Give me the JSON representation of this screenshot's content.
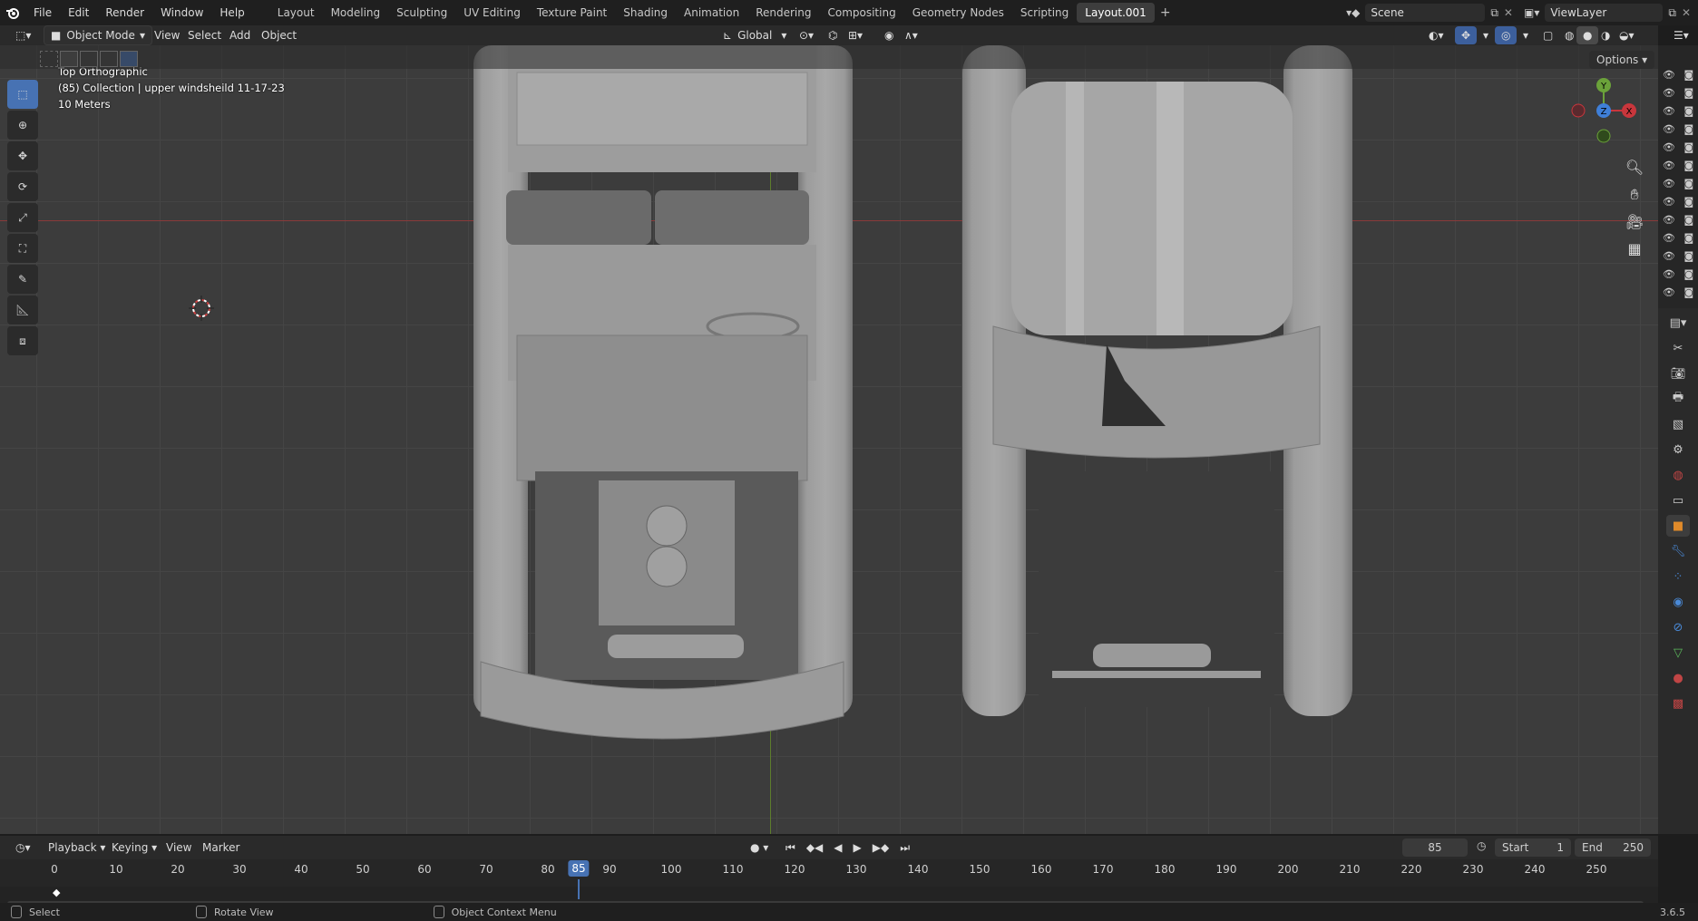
{
  "menubar": {
    "items": [
      "File",
      "Edit",
      "Render",
      "Window",
      "Help"
    ],
    "workspaces": [
      "Layout",
      "Modeling",
      "Sculpting",
      "UV Editing",
      "Texture Paint",
      "Shading",
      "Animation",
      "Rendering",
      "Compositing",
      "Geometry Nodes",
      "Scripting",
      "Layout.001"
    ],
    "active_workspace": "Layout.001",
    "add_tab": "+",
    "scene": "Scene",
    "view_layer": "ViewLayer"
  },
  "header": {
    "mode": "Object Mode",
    "menus": [
      "View",
      "Select",
      "Add",
      "Object"
    ],
    "transform_orientation": "Global",
    "options_label": "Options"
  },
  "viewport": {
    "view_name": "Top Orthographic",
    "collection": "(85) Collection | upper windsheild 11-17-23",
    "scale": "10 Meters",
    "gizmo_axes": {
      "x": "X",
      "y": "Y",
      "z": "Z"
    }
  },
  "timeline": {
    "menus": [
      "Playback",
      "Keying",
      "View",
      "Marker"
    ],
    "current_frame": "85",
    "start_label": "Start",
    "start": "1",
    "end_label": "End",
    "end": "250",
    "ticks": [
      "0",
      "10",
      "20",
      "30",
      "40",
      "50",
      "60",
      "70",
      "80",
      "85",
      "90",
      "100",
      "110",
      "120",
      "130",
      "140",
      "150",
      "160",
      "170",
      "180",
      "190",
      "200",
      "210",
      "220",
      "230",
      "240",
      "250"
    ]
  },
  "statusbar": {
    "items": [
      "Select",
      "Rotate View",
      "Object Context Menu"
    ],
    "version": "3.6.5"
  },
  "colors": {
    "accent": "#4772b3",
    "x_axis": "#c9363c",
    "y_axis": "#6ba23a",
    "z_axis": "#3f7fd8"
  }
}
